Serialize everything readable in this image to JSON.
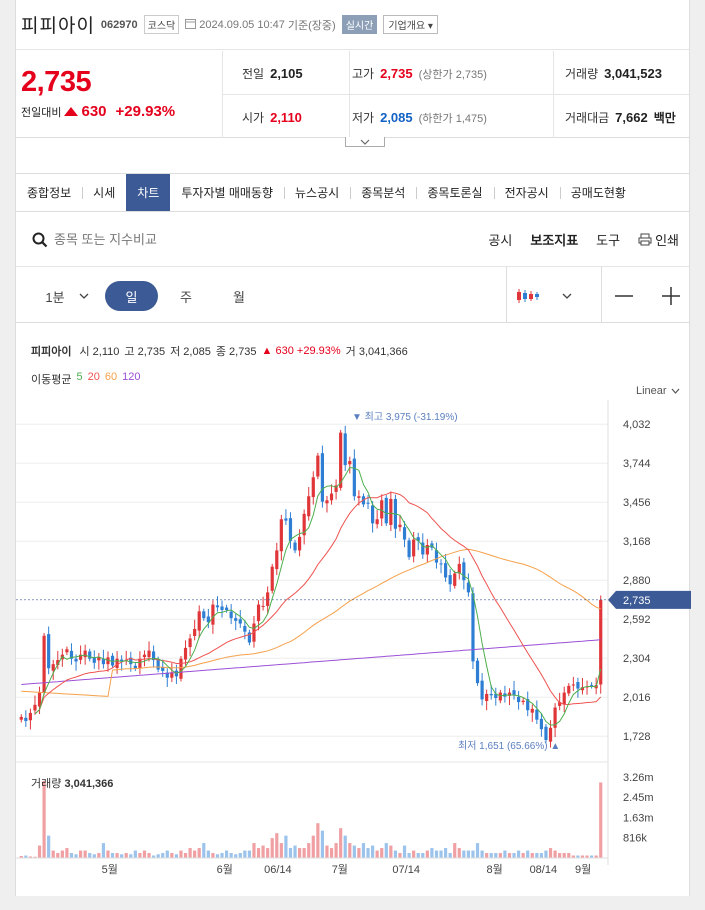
{
  "header": {
    "name": "피피아이",
    "code": "062970",
    "market": "코스닥",
    "datetime": "2024.09.05 10:47",
    "basis": "기준(장중)",
    "realtime": "실시간",
    "corp_info": "기업개요"
  },
  "quote": {
    "price": "2,735",
    "change_label": "전일대비",
    "change_amount": "630",
    "change_pct": "+29.93%",
    "prev_close_label": "전일",
    "prev_close": "2,105",
    "open_label": "시가",
    "open": "2,110",
    "high_label": "고가",
    "high": "2,735",
    "upper_limit": "(상한가 2,735)",
    "low_label": "저가",
    "low": "2,085",
    "lower_limit": "(하한가 1,475)",
    "volume_label": "거래량",
    "volume": "3,041,523",
    "amount_label": "거래대금",
    "amount": "7,662",
    "amount_unit": "백만"
  },
  "tabs": [
    "종합정보",
    "시세",
    "차트",
    "투자자별 매매동향",
    "뉴스공시",
    "종목분석",
    "종목토론실",
    "전자공시",
    "공매도현황"
  ],
  "active_tab": 2,
  "search": {
    "placeholder": "종목 또는 지수비교",
    "tools": [
      "공시",
      "보조지표",
      "도구",
      "인쇄"
    ]
  },
  "period": {
    "interval": "1분",
    "options": [
      "일",
      "주",
      "월"
    ],
    "active": "일"
  },
  "chart_info": {
    "name": "피피아이",
    "open_l": "시",
    "open": "2,110",
    "high_l": "고",
    "high": "2,735",
    "low_l": "저",
    "low": "2,085",
    "close_l": "종",
    "close": "2,735",
    "change": "630",
    "pct": "+29.93%",
    "vol_l": "거",
    "volume": "3,041,366",
    "ma_label": "이동평균",
    "ma": [
      {
        "n": "5",
        "color": "#4cae4c"
      },
      {
        "n": "20",
        "color": "#ef5350"
      },
      {
        "n": "60",
        "color": "#f5a04a"
      },
      {
        "n": "120",
        "color": "#9b4fd6"
      }
    ],
    "scale": "Linear",
    "max_label": "최고 3,975 (-31.19%)",
    "min_label": "최저 1,651 (65.66%)",
    "current_tag": "2,735",
    "volume_label": "거래량",
    "volume_value": "3,041,366"
  },
  "chart_data": {
    "type": "candlestick",
    "y_ticks": [
      "4,032",
      "3,744",
      "3,456",
      "3,168",
      "2,880",
      "2,592",
      "2,304",
      "2,016",
      "1,728"
    ],
    "ylim": [
      1700,
      4100
    ],
    "x_ticks": [
      "5월",
      "6월",
      "06/14",
      "7월",
      "07/14",
      "8월",
      "08/14",
      "9월"
    ],
    "volume_ticks": [
      "3.26m",
      "2.45m",
      "1.63m",
      "816k"
    ],
    "colors": {
      "up": "#e0363a",
      "down": "#2e7fd4",
      "ma5": "#4cae4c",
      "ma20": "#ef5350",
      "ma60": "#f5a04a",
      "ma120": "#9b4fd6"
    },
    "closes": [
      1870,
      1840,
      1900,
      1960,
      2050,
      2470,
      2230,
      2260,
      2290,
      2330,
      2370,
      2300,
      2280,
      2330,
      2360,
      2300,
      2270,
      2310,
      2260,
      2310,
      2250,
      2300,
      2280,
      2290,
      2260,
      2230,
      2300,
      2330,
      2360,
      2290,
      2220,
      2210,
      2160,
      2200,
      2170,
      2300,
      2380,
      2450,
      2520,
      2650,
      2600,
      2570,
      2700,
      2680,
      2660,
      2660,
      2600,
      2580,
      2560,
      2500,
      2420,
      2560,
      2700,
      2690,
      2790,
      2980,
      3100,
      3330,
      3320,
      3170,
      3100,
      3200,
      3370,
      3500,
      3640,
      3800,
      3460,
      3470,
      3520,
      3580,
      3970,
      3730,
      3760,
      3500,
      3500,
      3440,
      3450,
      3300,
      3330,
      3470,
      3300,
      3480,
      3260,
      3290,
      3180,
      3050,
      3180,
      3170,
      3070,
      3140,
      3120,
      3010,
      3000,
      2900,
      2850,
      2930,
      3000,
      2880,
      2790,
      2280,
      2120,
      2000,
      2040,
      2030,
      2010,
      2050,
      2020,
      2050,
      2030,
      1980,
      1990,
      1920,
      1930,
      1850,
      1780,
      1700,
      1790,
      1940,
      1980,
      2050,
      2100,
      2110,
      2080,
      2090,
      2095,
      2100,
      2105,
      2735
    ],
    "volumes": [
      0.08,
      0.1,
      0.06,
      0.05,
      0.5,
      3.1,
      0.9,
      0.3,
      0.2,
      0.3,
      0.4,
      0.2,
      0.15,
      0.3,
      0.3,
      0.2,
      0.15,
      0.2,
      0.6,
      0.3,
      0.2,
      0.2,
      0.15,
      0.2,
      0.15,
      0.3,
      0.2,
      0.3,
      0.2,
      0.1,
      0.15,
      0.2,
      0.3,
      0.2,
      0.15,
      0.3,
      0.2,
      0.4,
      0.3,
      0.4,
      0.6,
      0.3,
      0.2,
      0.15,
      0.2,
      0.3,
      0.2,
      0.15,
      0.2,
      0.3,
      0.3,
      0.6,
      0.4,
      0.5,
      0.4,
      0.8,
      1.0,
      0.6,
      0.9,
      0.4,
      0.5,
      0.4,
      0.4,
      0.6,
      0.9,
      1.4,
      1.1,
      0.5,
      0.4,
      0.6,
      1.2,
      0.9,
      0.6,
      0.5,
      0.4,
      0.6,
      0.4,
      0.5,
      0.3,
      0.4,
      0.6,
      0.5,
      0.3,
      0.2,
      0.5,
      0.2,
      0.3,
      0.2,
      0.2,
      0.3,
      0.4,
      0.3,
      0.3,
      0.4,
      0.2,
      0.6,
      0.4,
      0.3,
      0.3,
      0.3,
      0.6,
      0.3,
      0.2,
      0.2,
      0.2,
      0.2,
      0.3,
      0.2,
      0.2,
      0.3,
      0.2,
      0.3,
      0.2,
      0.2,
      0.2,
      0.3,
      0.4,
      0.3,
      0.2,
      0.2,
      0.2,
      0.1,
      0.1,
      0.1,
      0.1,
      0.1,
      0.1,
      3.04
    ]
  }
}
